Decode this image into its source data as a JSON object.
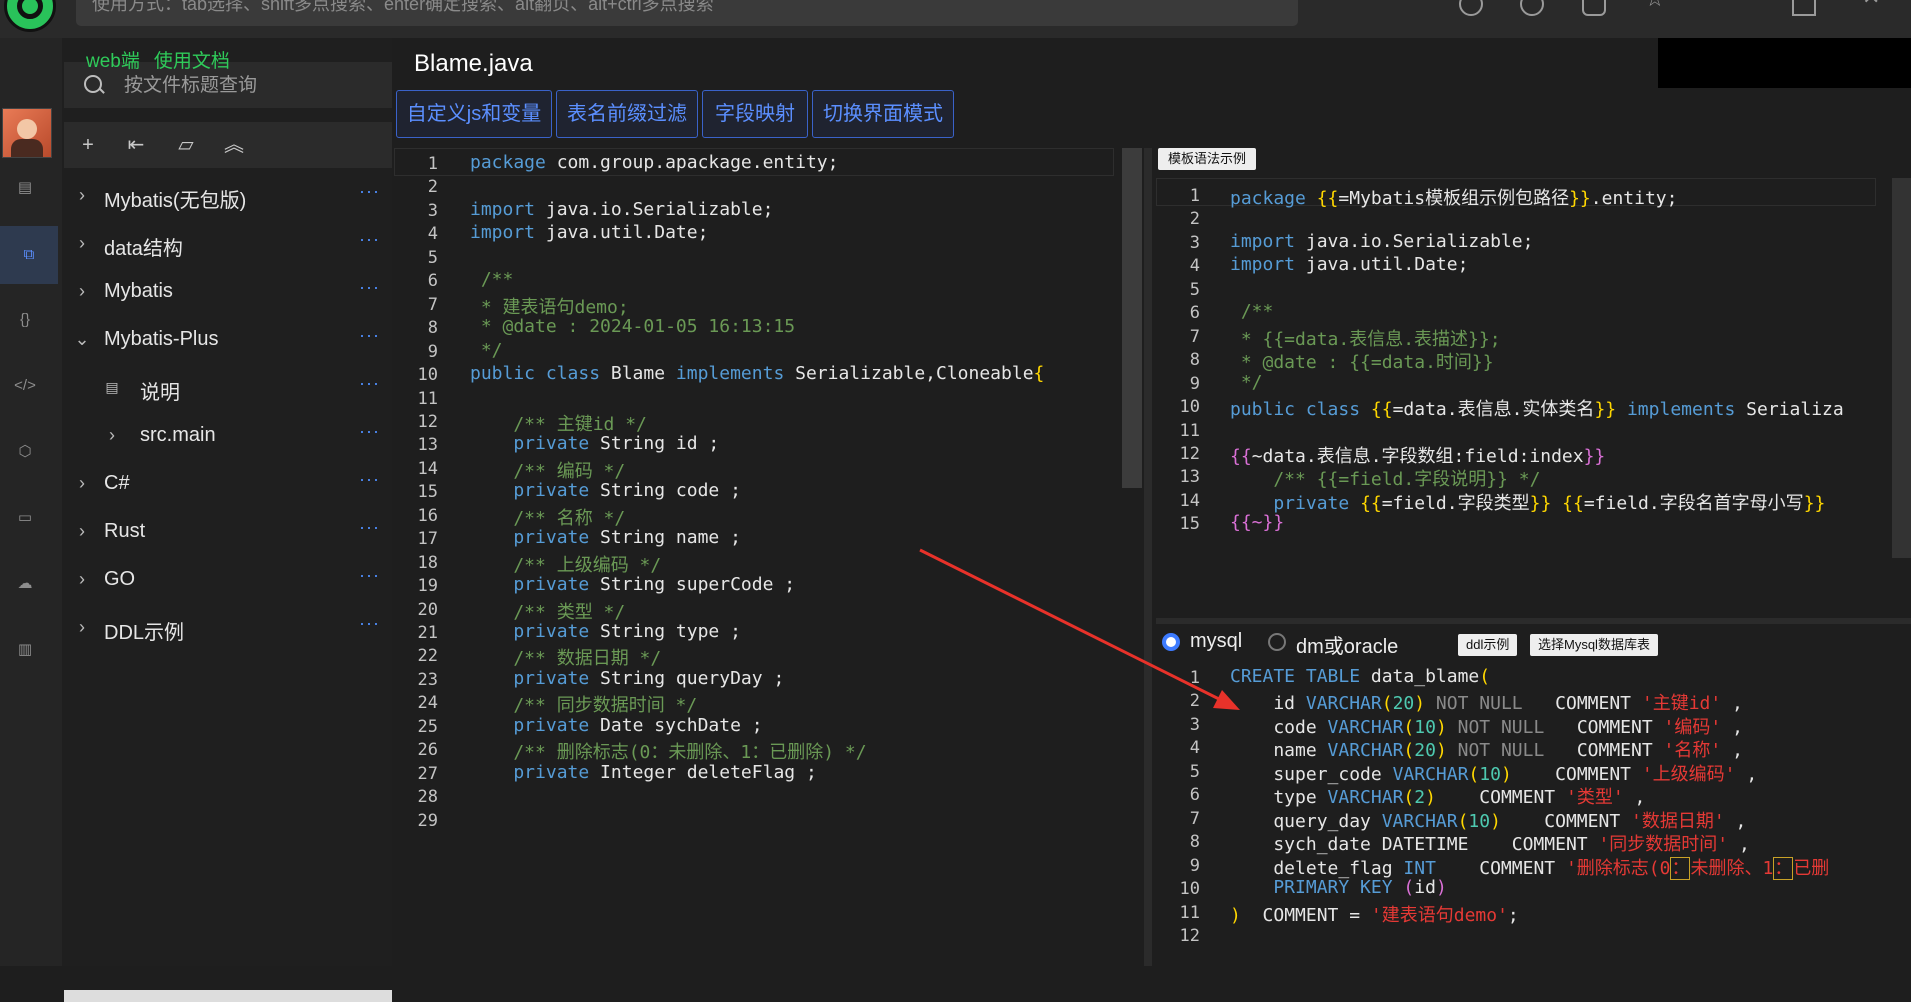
{
  "top": {
    "command_placeholder": "使用方式：tab选择、shift多点搜索、enter确定搜索、alt翻页、alt+ctrl多点搜索"
  },
  "sidebar": {
    "links": [
      "web端",
      "使用文档"
    ],
    "search_placeholder": "按文件标题查询",
    "tree": [
      {
        "label": "Mybatis(无包版)",
        "expanded": false
      },
      {
        "label": "data结构",
        "expanded": false
      },
      {
        "label": "Mybatis",
        "expanded": false
      },
      {
        "label": "Mybatis-Plus",
        "expanded": true
      },
      {
        "label": "说明",
        "child": true,
        "file": true
      },
      {
        "label": "src.main",
        "child": true
      },
      {
        "label": "C#",
        "expanded": false
      },
      {
        "label": "Rust",
        "expanded": false
      },
      {
        "label": "GO",
        "expanded": false
      },
      {
        "label": "DDL示例",
        "expanded": false
      }
    ],
    "more_label": "···"
  },
  "main": {
    "tab_title": "Blame.java",
    "buttons": [
      "自定义js和变量",
      "表名前缀过滤",
      "字段映射",
      "切换界面模式"
    ],
    "template_tag": "模板语法示例",
    "db": {
      "options": [
        "mysql",
        "dm或oracle"
      ],
      "selected": "mysql",
      "buttons": [
        "ddl示例",
        "选择Mysql数据库表"
      ]
    }
  },
  "left_code": [
    [
      [
        "kw",
        "package"
      ],
      [
        "tx",
        " com.group.apackage.entity;"
      ]
    ],
    [],
    [
      [
        "kw",
        "import"
      ],
      [
        "tx",
        " java.io.Serializable;"
      ]
    ],
    [
      [
        "kw",
        "import"
      ],
      [
        "tx",
        " java.util.Date;"
      ]
    ],
    [],
    [
      [
        "cm",
        " /**"
      ]
    ],
    [
      [
        "cm",
        " * 建表语句demo;"
      ]
    ],
    [
      [
        "cm",
        " * @date : 2024-01-05 16:13:15"
      ]
    ],
    [
      [
        "cm",
        " */"
      ]
    ],
    [
      [
        "kw",
        "public class"
      ],
      [
        "tx",
        " Blame "
      ],
      [
        "kw",
        "implements"
      ],
      [
        "tx",
        " Serializable,Cloneable"
      ],
      [
        "br",
        "{"
      ]
    ],
    [],
    [
      [
        "cm",
        "    /** 主键id */"
      ]
    ],
    [
      [
        "kw",
        "    private"
      ],
      [
        "tx",
        " String id ;"
      ]
    ],
    [
      [
        "cm",
        "    /** 编码 */"
      ]
    ],
    [
      [
        "kw",
        "    private"
      ],
      [
        "tx",
        " String code ;"
      ]
    ],
    [
      [
        "cm",
        "    /** 名称 */"
      ]
    ],
    [
      [
        "kw",
        "    private"
      ],
      [
        "tx",
        " String name ;"
      ]
    ],
    [
      [
        "cm",
        "    /** 上级编码 */"
      ]
    ],
    [
      [
        "kw",
        "    private"
      ],
      [
        "tx",
        " String superCode ;"
      ]
    ],
    [
      [
        "cm",
        "    /** 类型 */"
      ]
    ],
    [
      [
        "kw",
        "    private"
      ],
      [
        "tx",
        " String type ;"
      ]
    ],
    [
      [
        "cm",
        "    /** 数据日期 */"
      ]
    ],
    [
      [
        "kw",
        "    private"
      ],
      [
        "tx",
        " String queryDay ;"
      ]
    ],
    [
      [
        "cm",
        "    /** 同步数据时间 */"
      ]
    ],
    [
      [
        "kw",
        "    private"
      ],
      [
        "tx",
        " Date sychDate ;"
      ]
    ],
    [
      [
        "cm",
        "    /** 删除标志(0：未删除、1：已删除) */"
      ]
    ],
    [
      [
        "kw",
        "    private"
      ],
      [
        "tx",
        " Integer deleteFlag ;"
      ]
    ],
    [],
    []
  ],
  "right_top_code": [
    [
      [
        "kw",
        "package"
      ],
      [
        "tx",
        " "
      ],
      [
        "br",
        "{{"
      ],
      [
        "tx",
        "=Mybatis模板组示例包路径"
      ],
      [
        "br",
        "}}"
      ],
      [
        "tx",
        ".entity;"
      ]
    ],
    [],
    [
      [
        "kw",
        "import"
      ],
      [
        "tx",
        " java.io.Serializable;"
      ]
    ],
    [
      [
        "kw",
        "import"
      ],
      [
        "tx",
        " java.util.Date;"
      ]
    ],
    [],
    [
      [
        "cm",
        " /**"
      ]
    ],
    [
      [
        "cm",
        " * {{=data.表信息.表描述}};"
      ]
    ],
    [
      [
        "cm",
        " * @date : {{=data.时间}}"
      ]
    ],
    [
      [
        "cm",
        " */"
      ]
    ],
    [
      [
        "kw",
        "public class"
      ],
      [
        "tx",
        " "
      ],
      [
        "br",
        "{{"
      ],
      [
        "tx",
        "=data.表信息.实体类名"
      ],
      [
        "br",
        "}}"
      ],
      [
        "tx",
        " "
      ],
      [
        "kw",
        "implements"
      ],
      [
        "tx",
        " Serializa"
      ]
    ],
    [],
    [
      [
        "br2",
        "{{"
      ],
      [
        "tx",
        "~data.表信息.字段数组:field:index"
      ],
      [
        "br2",
        "}}"
      ]
    ],
    [
      [
        "cm",
        "    /** {{=field.字段说明}} */"
      ]
    ],
    [
      [
        "kw",
        "    private"
      ],
      [
        "tx",
        " "
      ],
      [
        "br",
        "{{"
      ],
      [
        "tx",
        "=field.字段类型"
      ],
      [
        "br",
        "}}"
      ],
      [
        "tx",
        " "
      ],
      [
        "br",
        "{{"
      ],
      [
        "tx",
        "=field.字段名首字母小写"
      ],
      [
        "br",
        "}}"
      ]
    ],
    [
      [
        "br2",
        "{{~}}"
      ]
    ]
  ],
  "right_bottom_code": [
    [
      [
        "kw",
        "CREATE TABLE"
      ],
      [
        "tx",
        " data_blame"
      ],
      [
        "br",
        "("
      ]
    ],
    [
      [
        "tx",
        "    id "
      ],
      [
        "kw",
        "VARCHAR"
      ],
      [
        "br",
        "("
      ],
      [
        "tp",
        "20"
      ],
      [
        "br",
        ")"
      ],
      [
        "gr",
        " NOT NULL"
      ],
      [
        "tx",
        "   COMMENT "
      ],
      [
        "str",
        "'主键id'"
      ],
      [
        "tx",
        " ,"
      ]
    ],
    [
      [
        "tx",
        "    code "
      ],
      [
        "kw",
        "VARCHAR"
      ],
      [
        "br",
        "("
      ],
      [
        "tp",
        "10"
      ],
      [
        "br",
        ")"
      ],
      [
        "gr",
        " NOT NULL"
      ],
      [
        "tx",
        "   COMMENT "
      ],
      [
        "str",
        "'编码'"
      ],
      [
        "tx",
        " ,"
      ]
    ],
    [
      [
        "tx",
        "    name "
      ],
      [
        "kw",
        "VARCHAR"
      ],
      [
        "br",
        "("
      ],
      [
        "tp",
        "20"
      ],
      [
        "br",
        ")"
      ],
      [
        "gr",
        " NOT NULL"
      ],
      [
        "tx",
        "   COMMENT "
      ],
      [
        "str",
        "'名称'"
      ],
      [
        "tx",
        " ,"
      ]
    ],
    [
      [
        "tx",
        "    super_code "
      ],
      [
        "kw",
        "VARCHAR"
      ],
      [
        "br",
        "("
      ],
      [
        "tp",
        "10"
      ],
      [
        "br",
        ")"
      ],
      [
        "tx",
        "    COMMENT "
      ],
      [
        "str",
        "'上级编码'"
      ],
      [
        "tx",
        " ,"
      ]
    ],
    [
      [
        "tx",
        "    type "
      ],
      [
        "kw",
        "VARCHAR"
      ],
      [
        "br",
        "("
      ],
      [
        "tp",
        "2"
      ],
      [
        "br",
        ")"
      ],
      [
        "tx",
        "    COMMENT "
      ],
      [
        "str",
        "'类型'"
      ],
      [
        "tx",
        " ,"
      ]
    ],
    [
      [
        "tx",
        "    query_day "
      ],
      [
        "kw",
        "VARCHAR"
      ],
      [
        "br",
        "("
      ],
      [
        "tp",
        "10"
      ],
      [
        "br",
        ")"
      ],
      [
        "tx",
        "    COMMENT "
      ],
      [
        "str",
        "'数据日期'"
      ],
      [
        "tx",
        " ,"
      ]
    ],
    [
      [
        "tx",
        "    sych_date DATETIME    COMMENT "
      ],
      [
        "str",
        "'同步数据时间'"
      ],
      [
        "tx",
        " ,"
      ]
    ],
    [
      [
        "tx",
        "    delete_flag "
      ],
      [
        "kw",
        "INT"
      ],
      [
        "tx",
        "    COMMENT "
      ],
      [
        "str",
        "'删除标志(0"
      ],
      [
        "str box",
        "："
      ],
      [
        "str",
        "未删除、1"
      ],
      [
        "str box",
        "："
      ],
      [
        "str",
        "已删"
      ]
    ],
    [
      [
        "kw",
        "    PRIMARY KEY"
      ],
      [
        "tx",
        " "
      ],
      [
        "br2",
        "("
      ],
      [
        "tx",
        "id"
      ],
      [
        "br2",
        ")"
      ]
    ],
    [
      [
        "br",
        ")"
      ],
      [
        "tx",
        "  COMMENT = "
      ],
      [
        "str",
        "'建表语句demo'"
      ],
      [
        "tx",
        ";"
      ]
    ],
    []
  ]
}
